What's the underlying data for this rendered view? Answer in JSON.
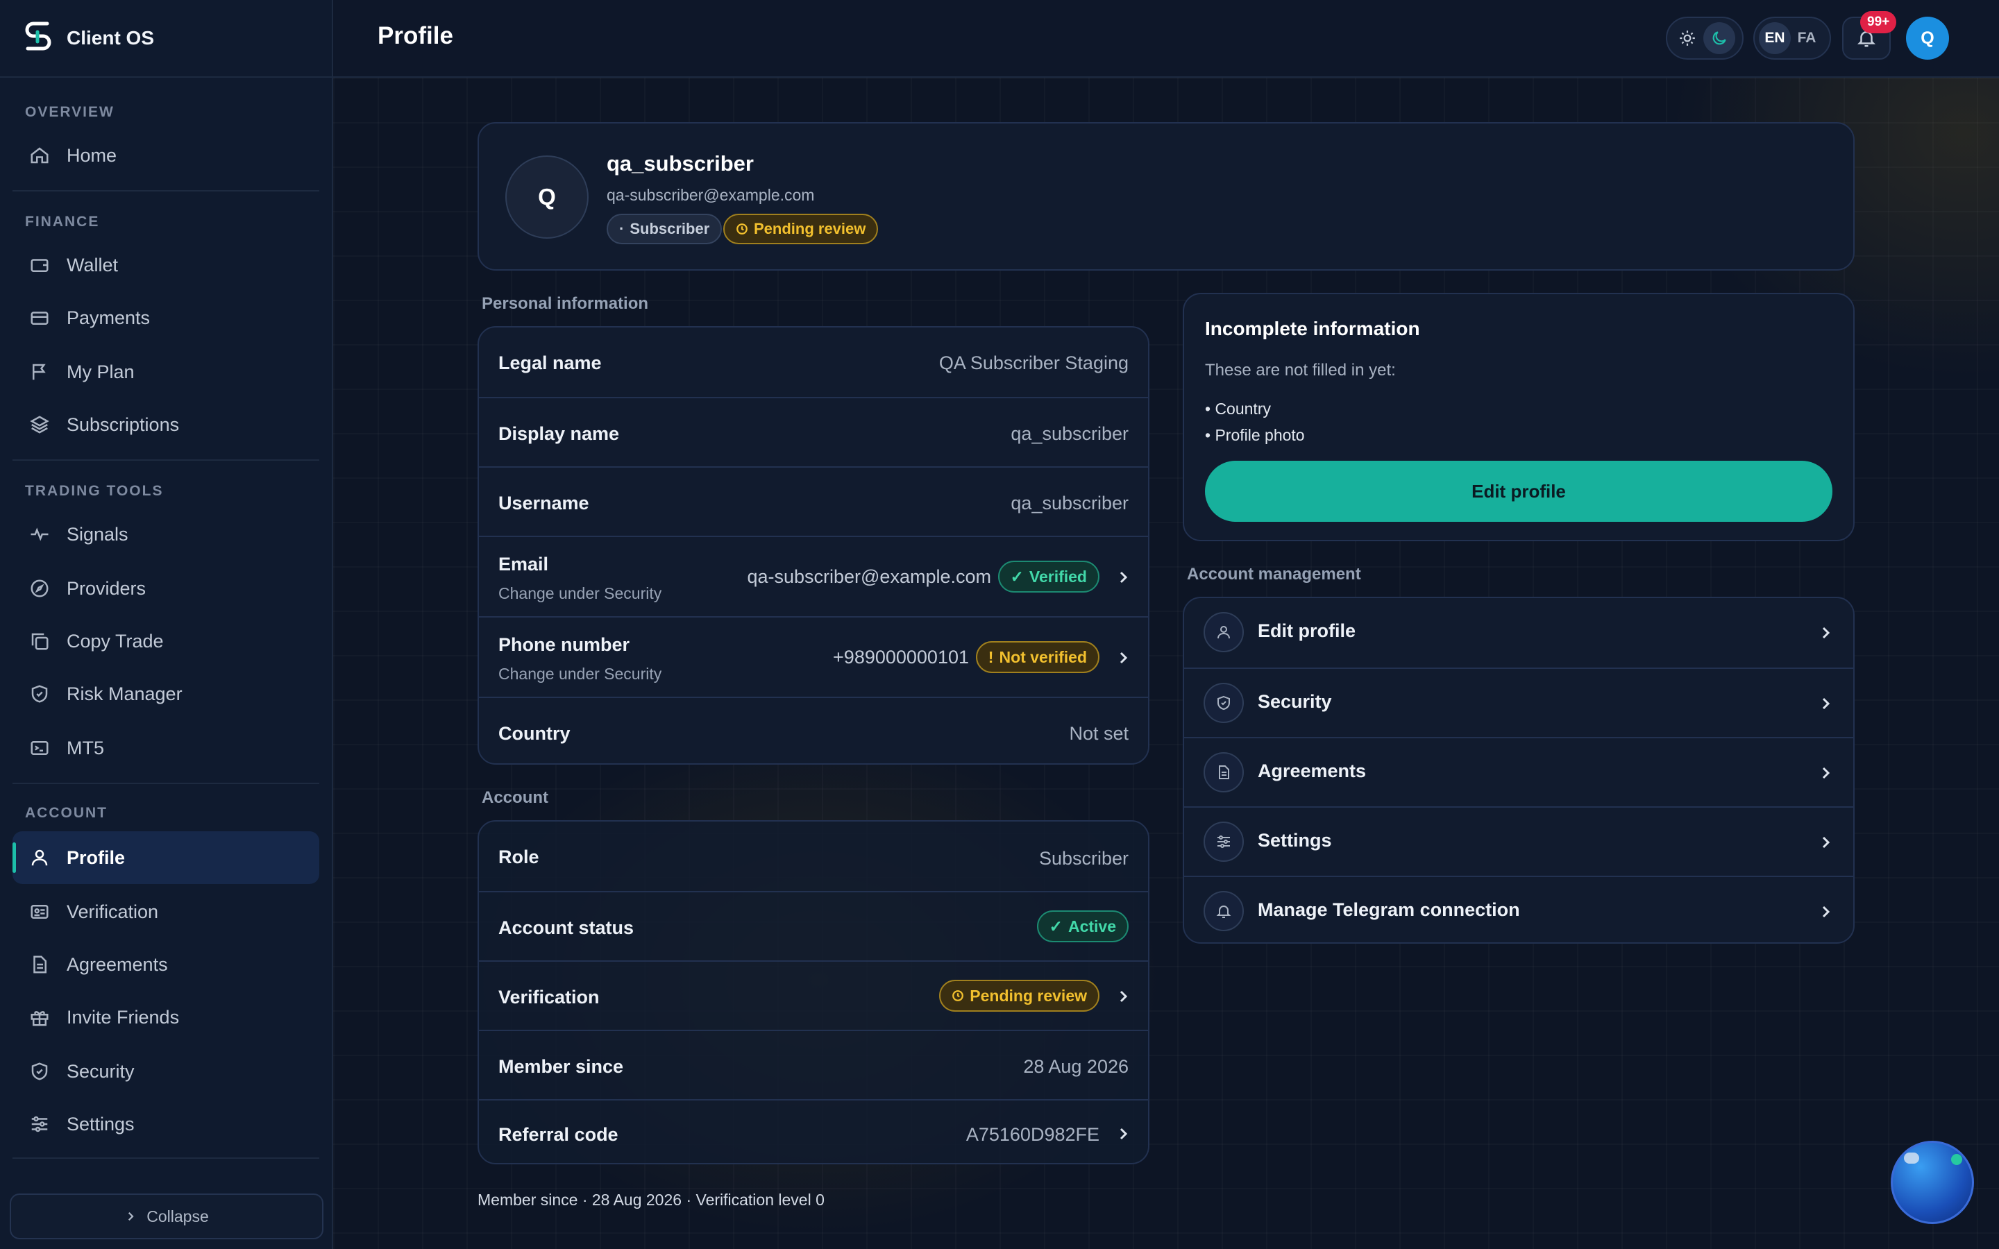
{
  "app": {
    "name": "Client OS"
  },
  "header": {
    "title": "Profile",
    "lang_en": "EN",
    "lang_fa": "FA",
    "notif_count": "99+",
    "avatar_initial": "Q"
  },
  "sidebar": {
    "sections": [
      {
        "title": "OVERVIEW",
        "items": [
          {
            "label": "Home",
            "icon": "home-icon"
          }
        ]
      },
      {
        "title": "FINANCE",
        "items": [
          {
            "label": "Wallet",
            "icon": "wallet-icon"
          },
          {
            "label": "Payments",
            "icon": "card-icon"
          },
          {
            "label": "My Plan",
            "icon": "flag-icon"
          },
          {
            "label": "Subscriptions",
            "icon": "layers-icon"
          }
        ]
      },
      {
        "title": "TRADING TOOLS",
        "items": [
          {
            "label": "Signals",
            "icon": "activity-icon"
          },
          {
            "label": "Providers",
            "icon": "compass-icon"
          },
          {
            "label": "Copy Trade",
            "icon": "copy-icon"
          },
          {
            "label": "Risk Manager",
            "icon": "shield-icon"
          },
          {
            "label": "MT5",
            "icon": "terminal-icon"
          }
        ]
      },
      {
        "title": "ACCOUNT",
        "items": [
          {
            "label": "Profile",
            "icon": "user-icon",
            "active": true
          },
          {
            "label": "Verification",
            "icon": "id-card-icon"
          },
          {
            "label": "Agreements",
            "icon": "document-icon"
          },
          {
            "label": "Invite Friends",
            "icon": "gift-icon"
          },
          {
            "label": "Security",
            "icon": "shield-icon"
          },
          {
            "label": "Settings",
            "icon": "sliders-icon"
          }
        ]
      }
    ],
    "collapse_label": "Collapse"
  },
  "profile": {
    "initial": "Q",
    "username": "qa_subscriber",
    "email": "qa-subscriber@example.com",
    "role_badge": "Subscriber",
    "status_badge": "Pending review"
  },
  "personal": {
    "title": "Personal information",
    "rows": [
      {
        "label": "Legal name",
        "value": "QA Subscriber Staging"
      },
      {
        "label": "Display name",
        "value": "qa_subscriber"
      },
      {
        "label": "Username",
        "value": "qa_subscriber"
      },
      {
        "label": "Email",
        "sub": "Change under Security",
        "value": "qa-subscriber@example.com",
        "badge": "Verified"
      },
      {
        "label": "Phone number",
        "sub": "Change under Security",
        "value": "+989000000101",
        "badge": "Not verified"
      },
      {
        "label": "Country",
        "value": "Not set"
      }
    ]
  },
  "account": {
    "title": "Account",
    "rows": [
      {
        "label": "Role",
        "value": "Subscriber"
      },
      {
        "label": "Account status",
        "badge": "Active"
      },
      {
        "label": "Verification",
        "badge": "Pending review"
      },
      {
        "label": "Member since",
        "value": "28 Aug 2026"
      },
      {
        "label": "Referral code",
        "value": "A75160D982FE"
      }
    ]
  },
  "footer_note": "Member since · 28 Aug 2026 · Verification level 0",
  "incomplete": {
    "title": "Incomplete information",
    "desc": "These are not filled in yet:",
    "items": [
      "• Country",
      "• Profile photo"
    ],
    "button": "Edit profile"
  },
  "management": {
    "title": "Account management",
    "items": [
      {
        "label": "Edit profile",
        "icon": "user-icon"
      },
      {
        "label": "Security",
        "icon": "shield-check-icon"
      },
      {
        "label": "Agreements",
        "icon": "document-icon"
      },
      {
        "label": "Settings",
        "icon": "sliders-icon"
      },
      {
        "label": "Manage Telegram connection",
        "icon": "bell-icon"
      }
    ]
  },
  "colors": {
    "accent": "#1dbfaa",
    "background": "#0d1525",
    "sidebar": "#0f1a2e",
    "warning": "#f2c02e",
    "success": "#42d8a9",
    "danger": "#e02146"
  }
}
